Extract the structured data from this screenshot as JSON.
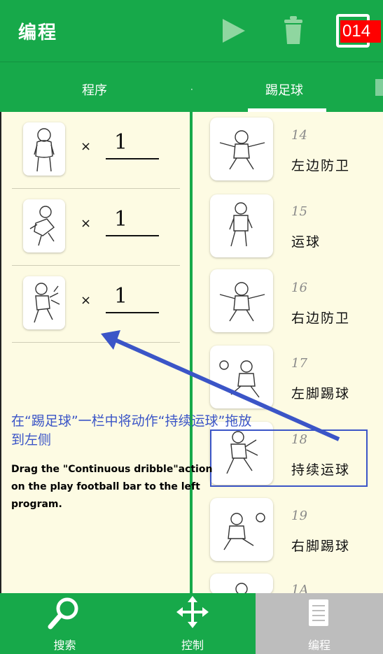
{
  "header": {
    "title": "编程",
    "counter": "014"
  },
  "tabs": [
    {
      "label": "程序"
    },
    {
      "label": "踢足球"
    }
  ],
  "program": [
    {
      "count": "1"
    },
    {
      "count": "1"
    },
    {
      "count": "1"
    }
  ],
  "multiply_symbol": "×",
  "actions": [
    {
      "num": "14",
      "name": "左边防卫"
    },
    {
      "num": "15",
      "name": "运球"
    },
    {
      "num": "16",
      "name": "右边防卫"
    },
    {
      "num": "17",
      "name": "左脚踢球"
    },
    {
      "num": "18",
      "name": "持续运球"
    },
    {
      "num": "19",
      "name": "右脚踢球"
    },
    {
      "num": "1A",
      "name": ""
    }
  ],
  "annotation": {
    "zh": "在“踢足球”一栏中将动作“持续运球”拖放到左侧",
    "en": "Drag the \"Continuous dribble\"action on the play football bar to the left program."
  },
  "bottom_nav": [
    {
      "label": "搜索",
      "icon": "search-icon"
    },
    {
      "label": "控制",
      "icon": "move-icon"
    },
    {
      "label": "编程",
      "icon": "document-icon"
    }
  ],
  "colors": {
    "primary": "#17a94a",
    "background": "#fdfbe3",
    "annotation": "#3b55c7",
    "counter_bg": "#ff0000"
  }
}
